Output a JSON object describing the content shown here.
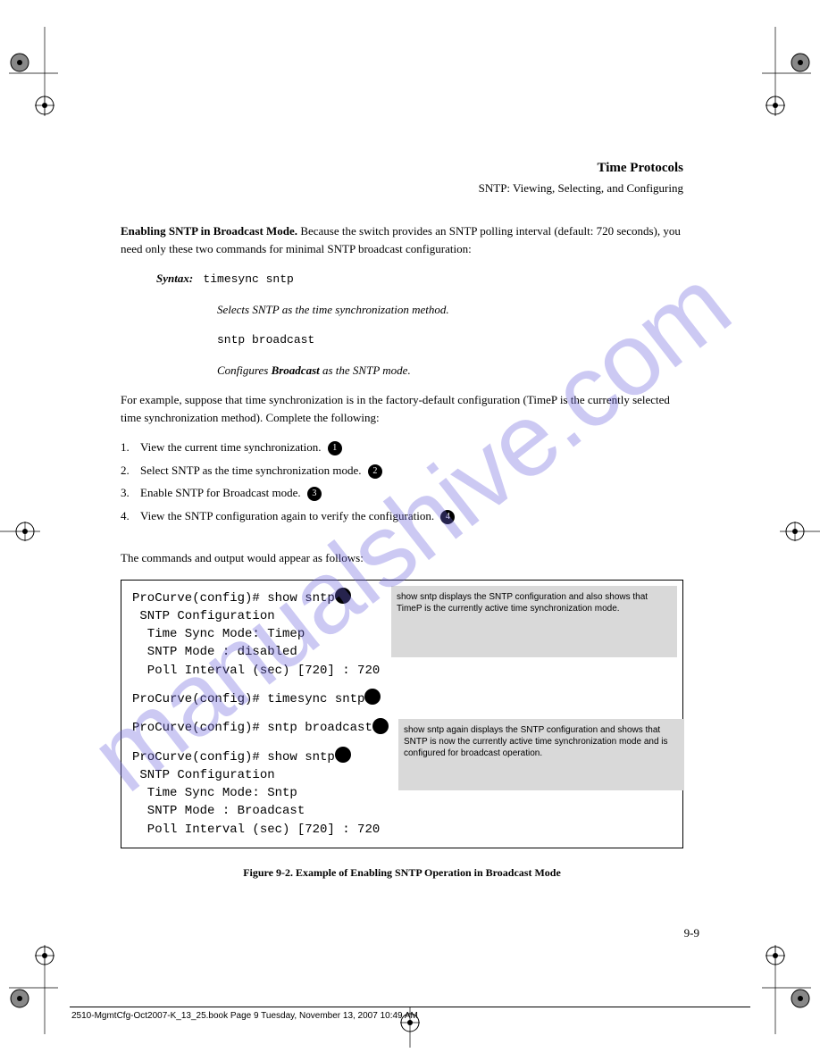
{
  "watermark": "manualshive.com",
  "header": {
    "title": "Time Protocols",
    "subtitle": "SNTP: Viewing, Selecting, and Configuring"
  },
  "body": {
    "para1_bold": "Enabling SNTP in Broadcast Mode.",
    "para1_text": " Because the switch provides an SNTP polling interval (default: 720 seconds), you need only these two commands for minimal SNTP broadcast configuration:",
    "syntax_label": "Syntax:",
    "syntax_cmd1": "timesync sntp",
    "syntax_desc1": "Selects SNTP as the time synchronization method.",
    "syntax_cmd2": "sntp broadcast",
    "syntax_desc2": "Configures ",
    "syntax_desc2_bold": "Broadcast",
    "syntax_desc2_after": " as the SNTP mode.",
    "para2": "For example, suppose that time synchronization is in the factory-default configuration (TimeP is the currently selected time synchronization method). Complete the following:",
    "steps": [
      {
        "num": "1.",
        "text": "View the current time synchronization."
      },
      {
        "num": "2.",
        "text": "Select SNTP as the time synchronization mode."
      },
      {
        "num": "3.",
        "text": "Enable SNTP for Broadcast mode."
      },
      {
        "num": "4.",
        "text": "View the SNTP configuration again to verify the configuration."
      }
    ],
    "commands_caption": "The commands and output would appear as follows:"
  },
  "terminal": {
    "line1": "ProCurve(config)# show sntp",
    "line2": " SNTP Configuration",
    "line3": "  Time Sync Mode: Timep",
    "line4": "  SNTP Mode : disabled",
    "line5": "  Poll Interval (sec) [720] : 720",
    "line6": "ProCurve(config)# timesync sntp",
    "line7": "ProCurve(config)# sntp broadcast",
    "line8": "ProCurve(config)# show sntp",
    "line9": " SNTP Configuration",
    "line10": "  Time Sync Mode: Sntp",
    "line11": "  SNTP Mode : Broadcast",
    "line12": "  Poll Interval (sec) [720] : 720",
    "callout1": "show sntp displays the SNTP configuration and also shows that TimeP is the currently active time synchronization mode.",
    "callout2": "show sntp again displays the SNTP configuration and shows that SNTP is now the currently active time synchronization mode and is configured for broadcast operation."
  },
  "figure_caption": "Figure 9-2. Example of Enabling SNTP Operation in Broadcast Mode",
  "page_number": "9-9",
  "footer": {
    "file": "2510-MgmtCfg-Oct2007-K_13_25.book  Page 9  Tuesday, November 13, 2007  10:49 AM",
    "date": ""
  }
}
